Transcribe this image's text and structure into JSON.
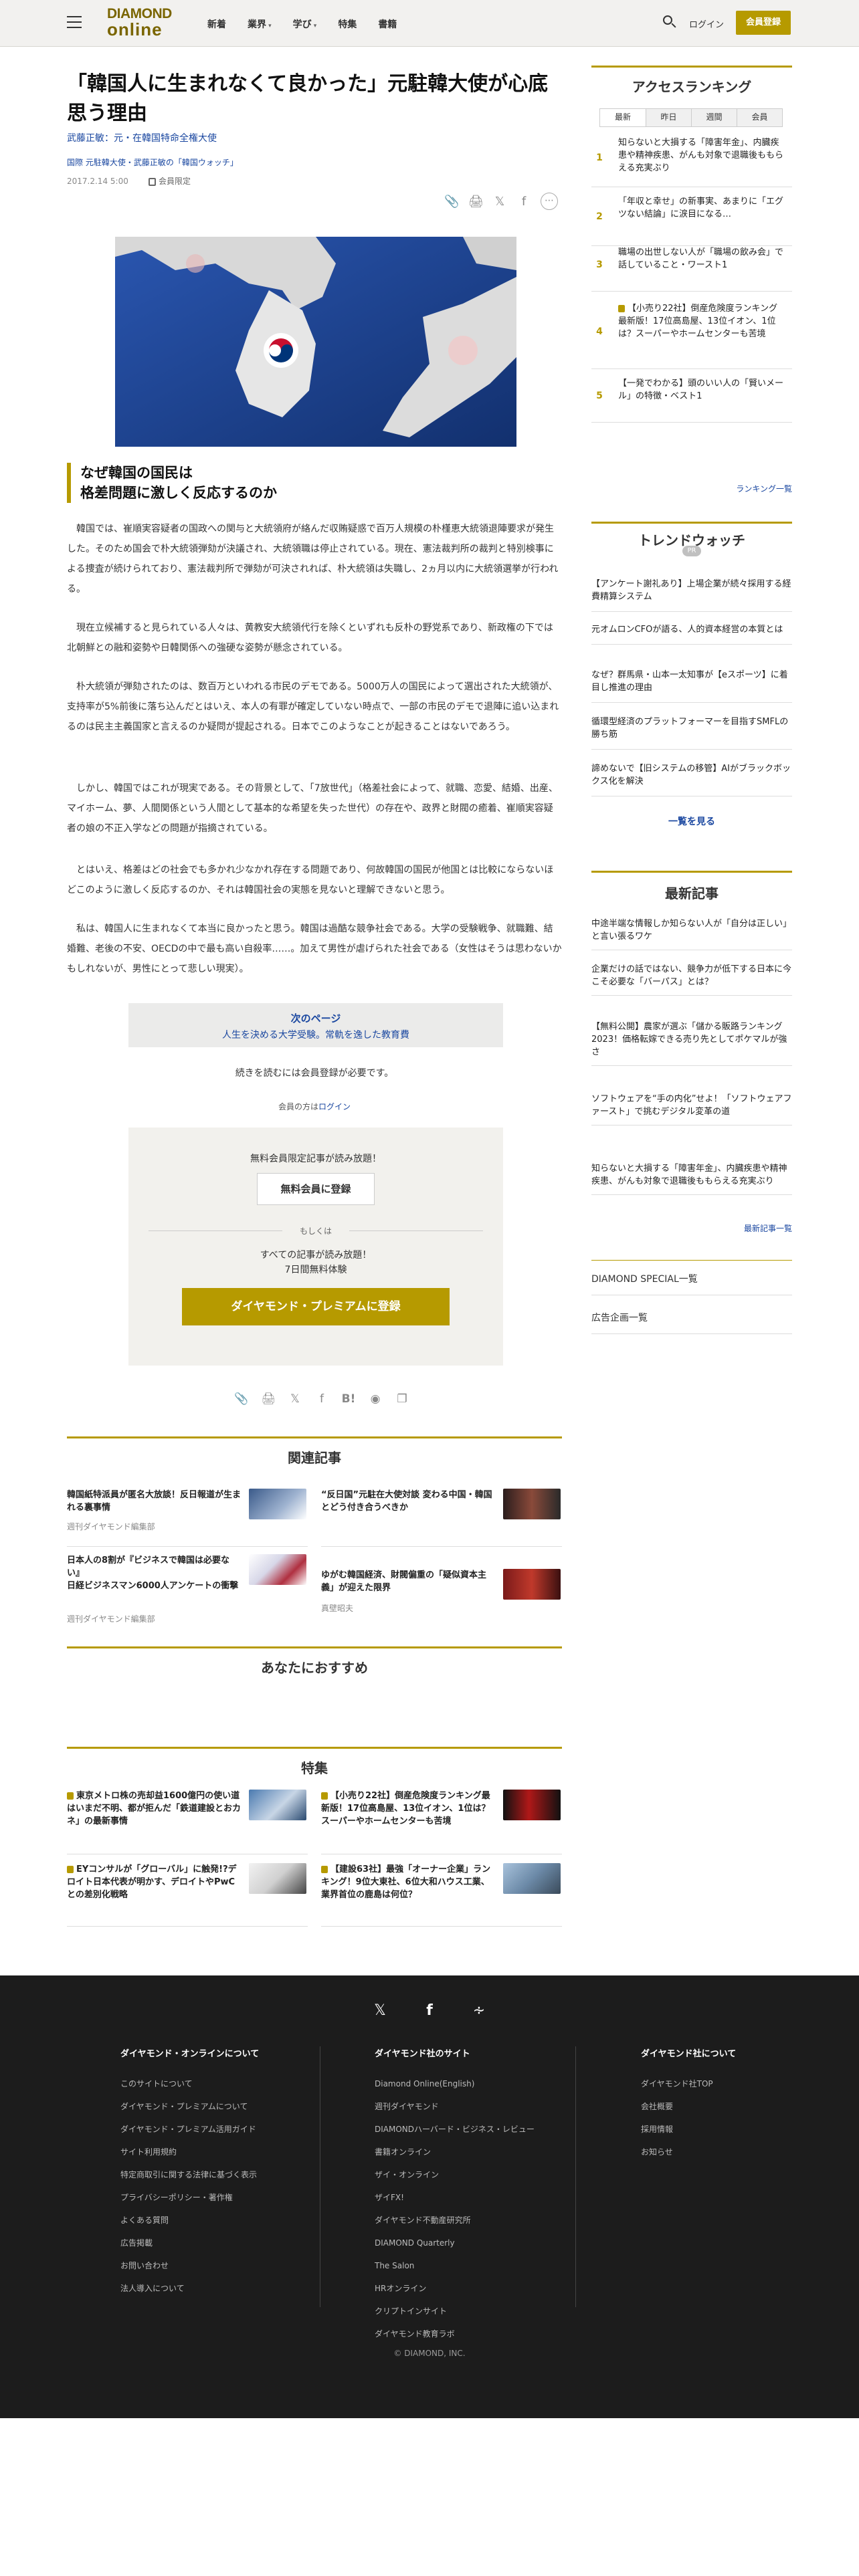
{
  "header": {
    "logo_top": "DIAMOND",
    "logo_bottom": "online",
    "nav": [
      "新着",
      "業界",
      "学び",
      "特集",
      "書籍"
    ],
    "login": "ログイン",
    "register": "会員登録"
  },
  "article": {
    "title": "「韓国人に生まれなくて良かった」元駐韓大使が心底思う理由",
    "author": "武藤正敏：元・在韓国特命全権大使",
    "categories": [
      "国際",
      "元駐韓大使・武藤正敏の「韓国ウォッチ」"
    ],
    "date": "2017.2.14 5:00",
    "member_limited": "会員限定",
    "subheading": "なぜ韓国の国民は\n格差問題に激しく反応するのか",
    "paragraphs": [
      "韓国では、崔順実容疑者の国政への関与と大統領府が絡んだ収賄疑惑で百万人規模の朴槿恵大統領退陣要求が発生した。そのため国会で朴大統領弾劾が決議され、大統領職は停止されている。現在、憲法裁判所の裁判と特別検事による捜査が続けられており、憲法裁判所で弾劾が可決されれば、朴大統領は失職し、2ヵ月以内に大統領選挙が行われる。",
      "現在立候補すると見られている人々は、黄教安大統領代行を除くといずれも反朴の野党系であり、新政権の下では北朝鮮との融和姿勢や日韓関係への強硬な姿勢が懸念されている。",
      "朴大統領が弾劾されたのは、数百万といわれる市民のデモである。5000万人の国民によって選出された大統領が、支持率が5%前後に落ち込んだとはいえ、本人の有罪が確定していない時点で、一部の市民のデモで退陣に追い込まれるのは民主主義国家と言えるのか疑問が提起される。日本でこのようなことが起きることはないであろう。",
      "しかし、韓国ではこれが現実である。その背景として、「7放世代」（格差社会によって、就職、恋愛、結婚、出産、マイホーム、夢、人間関係という人間として基本的な希望を失った世代）の存在や、政界と財閥の癒着、崔順実容疑者の娘の不正入学などの問題が指摘されている。",
      "とはいえ、格差はどの社会でも多かれ少なかれ存在する問題であり、何故韓国の国民が他国とは比較にならないほどこのように激しく反応するのか、それは韓国社会の実態を見ないと理解できないと思う。",
      "私は、韓国人に生まれなくて本当に良かったと思う。韓国は過酷な競争社会である。大学の受験戦争、就職難、結婚難、老後の不安、OECDの中で最も高い自殺率……。加えて男性が虐げられた社会である（女性はそうは思わないかもしれないが、男性にとって悲しい現実）。"
    ],
    "next_page_label": "次のページ",
    "next_page_title": "人生を決める大学受験。常軌を逸した教育費",
    "read_more": "続きを読むには会員登録が必要です。",
    "member_login_prefix": "会員の方は",
    "member_login_link": "ログイン",
    "free_note": "無料会員限定記事が読み放題！",
    "free_button": "無料会員に登録",
    "or": "もしくは",
    "premium_note1": "すべての記事が読み放題！",
    "premium_note2": "7日間無料体験",
    "premium_button": "ダイヤモンド・プレミアムに登録"
  },
  "related": {
    "title": "関連記事",
    "items": [
      {
        "title": "韓国紙特派員が匿名大放談！反日報道が生まれる裏事情",
        "source": "週刊ダイヤモンド編集部"
      },
      {
        "title": "“反日国”元駐在大使対談 変わる中国・韓国とどう付き合うべきか",
        "source": ""
      },
      {
        "title": "日本人の8割が『ビジネスで韓国は必要ない』\n日経ビジネスマン6000人アンケートの衝撃",
        "source": "週刊ダイヤモンド編集部"
      },
      {
        "title": "ゆがむ韓国経済、財閥偏重の「疑似資本主義」が迎えた限界",
        "source": "真壁昭夫"
      }
    ]
  },
  "recommend": {
    "title": "あなたにおすすめ"
  },
  "features": {
    "title": "特集",
    "items": [
      {
        "title": "東京メトロ株の売却益1600億円の使い道はいまだ不明、都が拒んだ「鉄道建設とおカネ」の最新事情",
        "locked": true
      },
      {
        "title": "【小売り22社】倒産危険度ランキング最新版！17位高島屋、13位イオン、1位は？スーパーやホームセンターも苦境",
        "locked": true
      },
      {
        "title": "EYコンサルが「グローバル」に触発!?デロイト日本代表が明かす、デロイトやPwCとの差別化戦略",
        "locked": true
      },
      {
        "title": "【建設63社】最強「オーナー企業」ランキング！9位大東社、6位大和ハウス工業、業界首位の鹿島は何位？",
        "locked": true
      }
    ]
  },
  "sidebar": {
    "ranking_title": "アクセスランキング",
    "tabs": [
      "最新",
      "昨日",
      "週間",
      "会員"
    ],
    "ranking": [
      {
        "num": "1",
        "title": "知らないと大損する「障害年金」、内臓疾患や精神疾患、がんも対象で退職後ももらえる充実ぶり",
        "locked": false
      },
      {
        "num": "2",
        "title": "「年収と幸せ」の新事実、あまりに「エグツない結論」に涙目になる…",
        "locked": false
      },
      {
        "num": "3",
        "title": "職場の出世しない人が「職場の飲み会」で話していること・ワースト1",
        "locked": false
      },
      {
        "num": "4",
        "title": "【小売り22社】倒産危険度ランキング最新版！17位高島屋、13位イオン、1位は？スーパーやホームセンターも苦境",
        "locked": true
      },
      {
        "num": "5",
        "title": "【一発でわかる】頭のいい人の「賢いメール」の特徴・ベスト1",
        "locked": false
      }
    ],
    "ranking_more": "ランキング一覧",
    "trend_title": "トレンドウォッチ",
    "trend_pr": "PR",
    "trend": [
      "【アンケート謝礼あり】上場企業が続々採用する経費精算システム",
      "元オムロンCFOが語る、人的資本経営の本質とは",
      "なぜ？群馬県・山本一太知事が【eスポーツ】に着目し推進の理由",
      "循環型経済のプラットフォーマーを目指すSMFLの勝ち筋",
      "諦めないで【旧システムの移管】AIがブラックボックス化を解決"
    ],
    "trend_more": "一覧を見る",
    "latest_title": "最新記事",
    "latest": [
      "中途半端な情報しか知らない人が「自分は正しい」と言い張るワケ",
      "企業だけの話ではない、競争力が低下する日本に今こそ必要な「バーパス」とは？",
      "【無料公開】農家が選ぶ「儲かる販路ランキング2023！価格転嫁できる売り先としてポケマルが強さ",
      "ソフトウェアを“手の内化”せよ！「ソフトウェアファースト」で挑むデジタル変革の道",
      "知らないと大損する「障害年金」、内臓疾患や精神疾患、がんも対象で退職後ももらえる充実ぶり"
    ],
    "latest_more": "最新記事一覧",
    "special": "DIAMOND SPECIAL一覧",
    "ad": "広告企画一覧"
  },
  "footer": {
    "col1_title": "ダイヤモンド・オンラインについて",
    "col1": [
      "このサイトについて",
      "ダイヤモンド・プレミアムについて",
      "ダイヤモンド・プレミアム活用ガイド",
      "サイト利用規約",
      "特定商取引に関する法律に基づく表示",
      "プライバシーポリシー・著作権",
      "よくある質問",
      "広告掲載",
      "お問い合わせ",
      "法人導入について"
    ],
    "col2_title": "ダイヤモンド社のサイト",
    "col2": [
      "Diamond Online(English)",
      "週刊ダイヤモンド",
      "DIAMONDハーバード・ビジネス・レビュー",
      "書籍オンライン",
      "ザイ・オンライン",
      "ザイFX!",
      "ダイヤモンド不動産研究所",
      "DIAMOND Quarterly",
      "The Salon",
      "HRオンライン",
      "クリプトインサイト",
      "ダイヤモンド教育ラボ"
    ],
    "col3_title": "ダイヤモンド社について",
    "col3": [
      "ダイヤモンド社TOP",
      "会社概要",
      "採用情報",
      "お知らせ"
    ],
    "copyright": "© DIAMOND, INC."
  }
}
